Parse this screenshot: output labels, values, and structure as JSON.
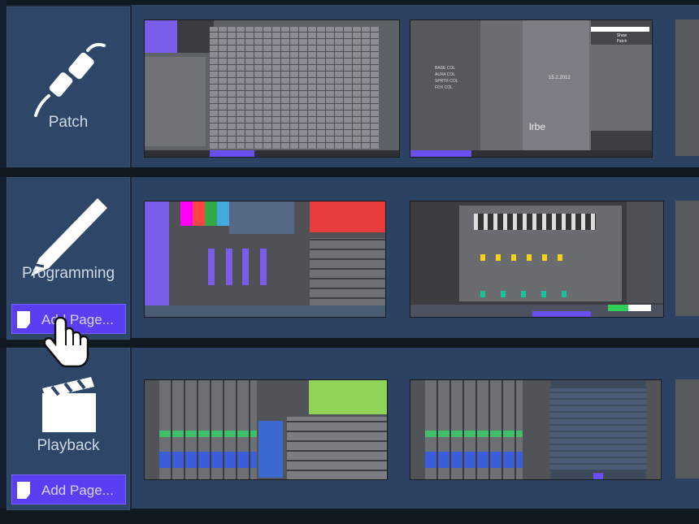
{
  "categories": [
    {
      "id": "patch",
      "label": "Patch",
      "icon": "plug-icon"
    },
    {
      "id": "programming",
      "label": "Programming",
      "icon": "pen-icon",
      "add_label": "Add Page..."
    },
    {
      "id": "playback",
      "label": "Playback",
      "icon": "clapperboard-icon",
      "add_label": "Add Page..."
    }
  ],
  "thumbs": {
    "patch_2": {
      "values": [
        {
          "label": "BASE COL",
          "v": "0"
        },
        {
          "label": "AUXA COL",
          "v": "0"
        },
        {
          "label": "SPRTR COL",
          "v": "0"
        },
        {
          "label": "FOX COL",
          "v": "0"
        }
      ],
      "date": "15.2.2012",
      "logo": "lrbe",
      "menu": [
        "Shaw",
        "Patch"
      ]
    }
  },
  "colors": {
    "accent": "#5a3ff2",
    "panel": "#2e4668",
    "row": "#2c4262",
    "thumb_gray": "#595c61"
  }
}
